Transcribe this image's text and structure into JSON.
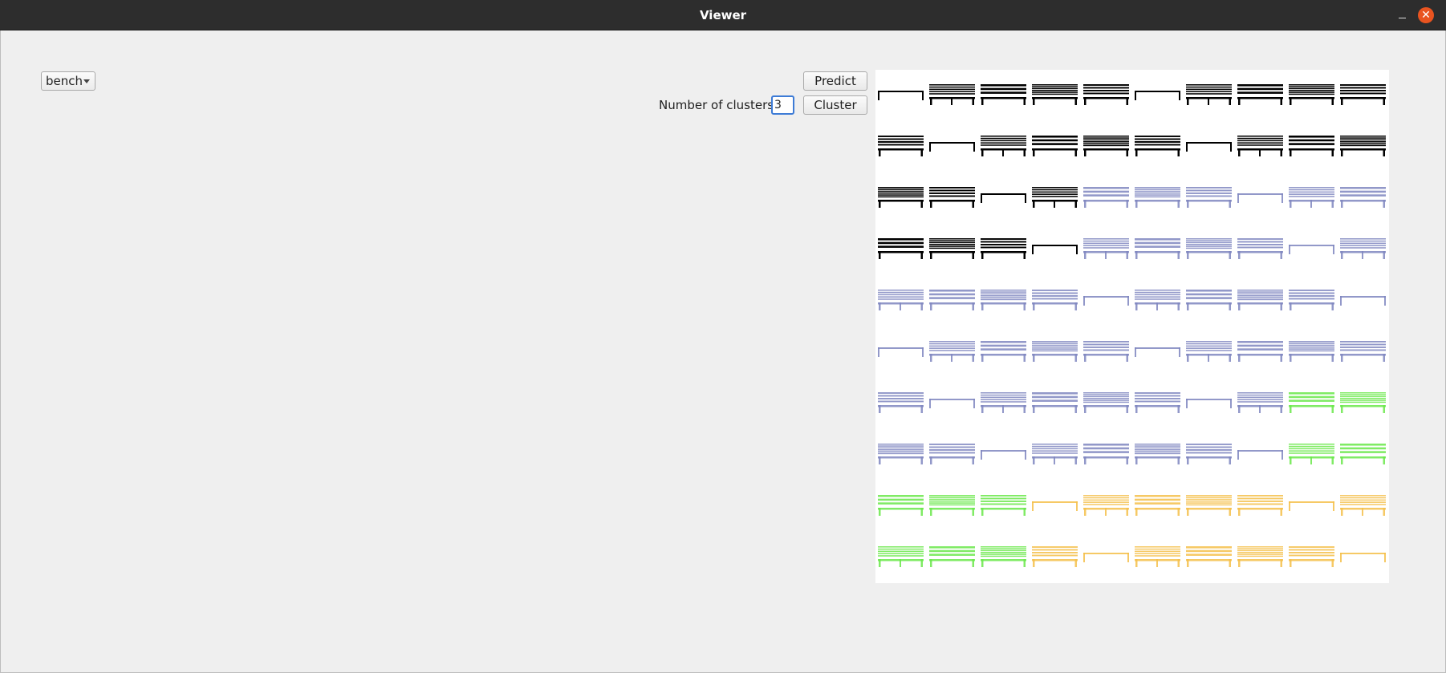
{
  "window": {
    "title": "Viewer",
    "minimize_symbol": "–",
    "close_symbol": "✕"
  },
  "controls": {
    "category_select": {
      "value": "bench"
    },
    "predict_label": "Predict",
    "cluster_label": "Cluster",
    "num_clusters_label": "Number of clusters:",
    "num_clusters_value": "3"
  },
  "grid": {
    "rows": 10,
    "cols": 10,
    "cluster_colors": {
      "K": "#000000",
      "B": "#7f86c0",
      "G": "#6ae84a",
      "Y": "#f5c04a"
    },
    "cells": [
      "KKKKKKKKKK",
      "KKKKKKKKKK",
      "KKKKBBBBBB",
      "KKKKBBBBBB",
      "BBBBBBBBBB",
      "BBBBBBBBBB",
      "BBBBBBBBGG",
      "BBBBBBBBGG",
      "GGGYYYYYYY",
      "GGGYYYYYYY"
    ]
  }
}
